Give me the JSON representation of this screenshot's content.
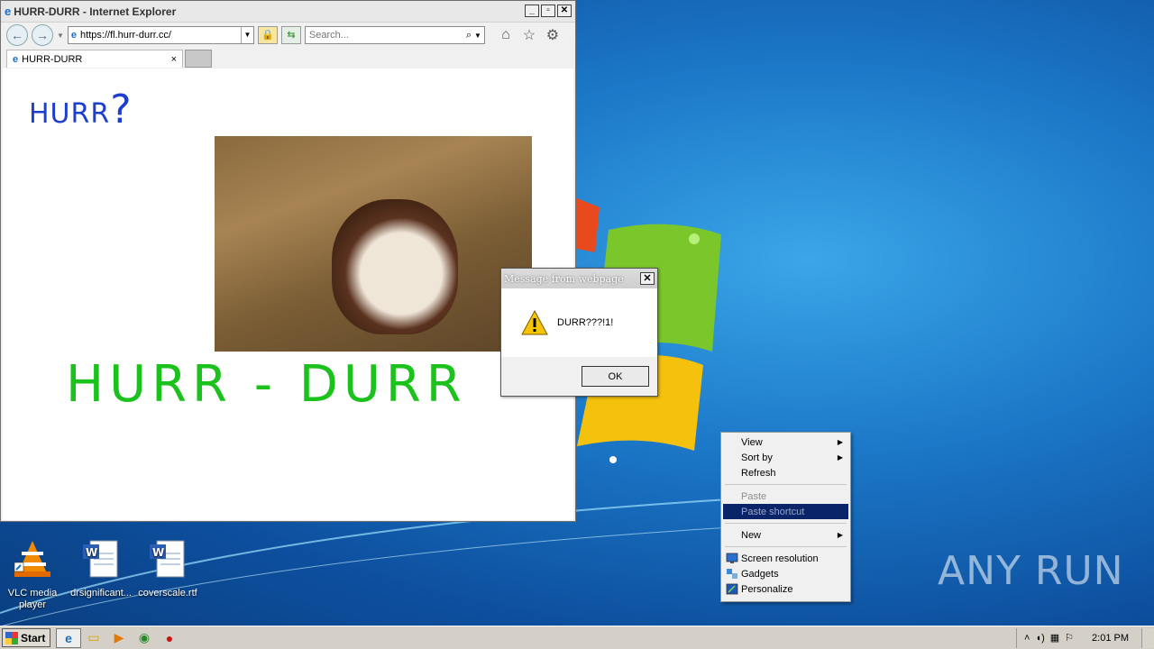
{
  "browser": {
    "window_title": "HURR-DURR - Internet Explorer",
    "address": "https://fl.hurr-durr.cc/",
    "search_placeholder": "Search...",
    "tab_label": "HURR-DURR"
  },
  "page": {
    "heading_small": "HURR",
    "heading_small_mark": "?",
    "heading_big": "HURR - DURR",
    "image_alt": "bulldog"
  },
  "dialog": {
    "title": "Message from webpage",
    "message": "DURR???!1!",
    "ok_label": "OK"
  },
  "context_menu": {
    "items": [
      {
        "label": "View",
        "submenu": true
      },
      {
        "label": "Sort by",
        "submenu": true
      },
      {
        "label": "Refresh"
      },
      {
        "label": "Paste",
        "disabled": true
      },
      {
        "label": "Paste shortcut",
        "disabled": true,
        "selected": true
      },
      {
        "label": "New",
        "submenu": true
      },
      {
        "label": "Screen resolution"
      },
      {
        "label": "Gadgets"
      },
      {
        "label": "Personalize"
      }
    ]
  },
  "desktop_icons": [
    {
      "label": "VLC media player",
      "icon": "vlc-icon"
    },
    {
      "label": "drsignificant...",
      "icon": "word-document-icon"
    },
    {
      "label": "coverscale.rtf",
      "icon": "word-document-icon"
    }
  ],
  "taskbar": {
    "start_label": "Start",
    "pinned": [
      "ie-icon",
      "explorer-icon",
      "media-player-icon",
      "chrome-icon",
      "opera-icon"
    ],
    "clock": "2:01 PM"
  },
  "watermark": "ANY RUN",
  "colors": {
    "heading_small": "#1d3fd0",
    "heading_big": "#1bc21b",
    "menu_highlight": "#0a246a"
  }
}
